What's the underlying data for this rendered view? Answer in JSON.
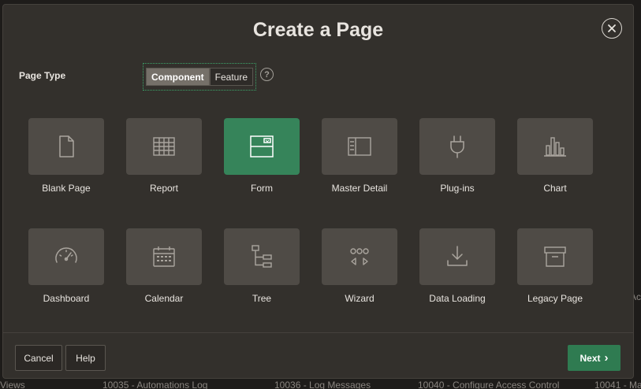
{
  "dialog": {
    "title": "Create a Page",
    "close_label": "Close",
    "page_type_label": "Page Type",
    "page_type_options": [
      "Component",
      "Feature"
    ],
    "selected_page_type": "Component",
    "help_glyph": "?"
  },
  "tiles": [
    {
      "label": "Blank Page",
      "icon": "blank-page-icon"
    },
    {
      "label": "Report",
      "icon": "report-grid-icon"
    },
    {
      "label": "Form",
      "icon": "form-icon",
      "selected": true
    },
    {
      "label": "Master Detail",
      "icon": "master-detail-icon"
    },
    {
      "label": "Plug-ins",
      "icon": "plug-icon"
    },
    {
      "label": "Chart",
      "icon": "bar-chart-icon"
    },
    {
      "label": "Dashboard",
      "icon": "gauge-icon"
    },
    {
      "label": "Calendar",
      "icon": "calendar-icon"
    },
    {
      "label": "Tree",
      "icon": "tree-icon"
    },
    {
      "label": "Wizard",
      "icon": "wizard-icon"
    },
    {
      "label": "Data Loading",
      "icon": "download-icon"
    },
    {
      "label": "Legacy Page",
      "icon": "archive-box-icon"
    }
  ],
  "footer": {
    "cancel_label": "Cancel",
    "help_label": "Help",
    "next_label": "Next",
    "next_glyph": "›"
  },
  "background": {
    "bottom_items": [
      "Views",
      "10035 - Automations Log",
      "10036 - Log Messages",
      "10040 - Configure Access Control",
      "10041 - Ma"
    ],
    "right_fragment": "Ac"
  },
  "colors": {
    "dialog_bg": "#33302c",
    "tile_bg": "#4f4b46",
    "accent": "#36845a",
    "text": "#e8e4df"
  }
}
